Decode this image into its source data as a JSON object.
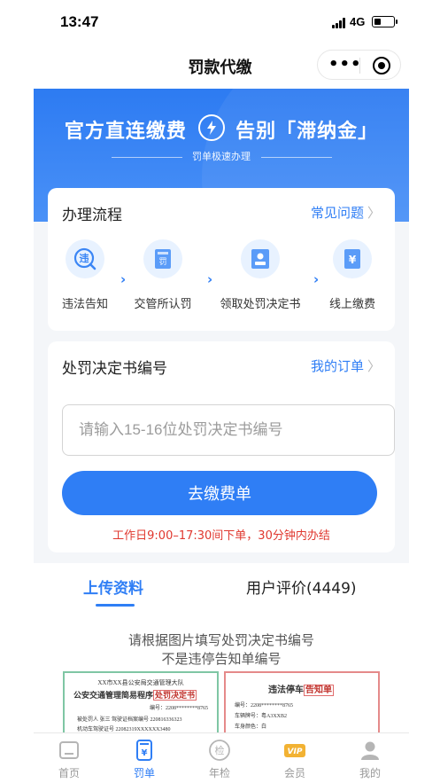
{
  "status_bar": {
    "time": "13:47",
    "network": "4G",
    "battery_level": 0.35
  },
  "nav": {
    "title": "罚款代缴"
  },
  "banner": {
    "headline_left": "官方直连缴费",
    "headline_right": "告别「滞纳金」",
    "subtitle": "罚单极速办理"
  },
  "process": {
    "title": "办理流程",
    "faq_link": "常见问题",
    "steps": [
      {
        "label": "违法告知",
        "icon": "violation-notice-icon"
      },
      {
        "label": "交管所认罚",
        "icon": "penalty-document-icon"
      },
      {
        "label": "领取处罚决定书",
        "icon": "decision-certificate-icon"
      },
      {
        "label": "线上缴费",
        "icon": "yuan-payment-icon"
      }
    ]
  },
  "decision": {
    "title": "处罚决定书编号",
    "orders_link": "我的订单",
    "input_placeholder": "请输入15-16位处罚决定书编号",
    "input_value": "",
    "submit_label": "去缴费单",
    "notice": "工作日9:00–17:30间下单，30分钟内办结"
  },
  "tabs": {
    "upload": "上传资料",
    "reviews": "用户评价(4449)"
  },
  "upload": {
    "hint_line1": "请根据图片填写处罚决定书编号",
    "hint_line2": "不是违停告知单编号",
    "sample_left": {
      "line1": "XX市XX县公安局交通管理大队",
      "line2_prefix": "公安交通管理简易程序",
      "line2_highlight": "处罚决定书",
      "line3": "编号：2208********8765",
      "line4": "被处罚人 张三      驾驶证档案编号 220816336323",
      "line5": "机动车驾驶证号 22082319XXXXXX3480"
    },
    "sample_right": {
      "title_prefix": "违法停车",
      "title_highlight": "告知单",
      "line1": "编号：2208********8765",
      "line2": "车辆牌号：粤A3XXB2",
      "line3": "车身颜色：白"
    }
  },
  "tabbar": {
    "items": [
      {
        "label": "首页",
        "icon": "home-icon",
        "active": false
      },
      {
        "label": "罚单",
        "icon": "ticket-icon",
        "active": true
      },
      {
        "label": "年检",
        "icon": "inspection-icon",
        "active": false
      },
      {
        "label": "会员",
        "icon": "vip-icon",
        "active": false
      },
      {
        "label": "我的",
        "icon": "profile-icon",
        "active": false
      }
    ],
    "vip_badge": "VIP",
    "inspection_badge": "检"
  },
  "colors": {
    "primary": "#2f7ef5",
    "danger": "#e0382f",
    "banner": "#3b86f5"
  }
}
